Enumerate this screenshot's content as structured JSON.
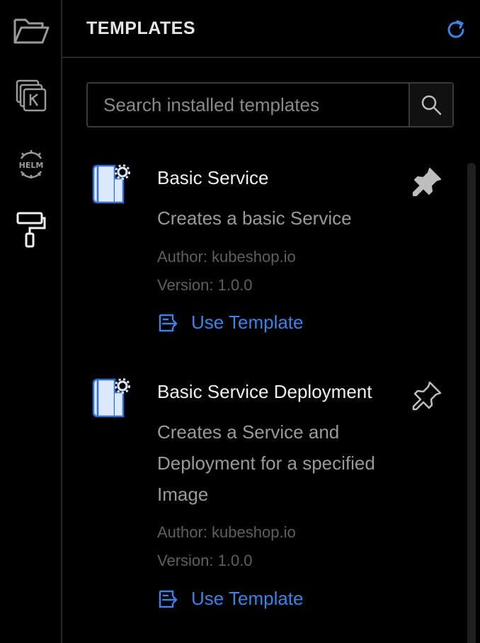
{
  "activity_bar": {
    "items": [
      {
        "icon": "folder-open-icon",
        "active": false
      },
      {
        "icon": "kustomize-icon",
        "active": false
      },
      {
        "icon": "helm-icon",
        "label": "HELM",
        "active": false
      },
      {
        "icon": "paint-roller-icon",
        "active": true
      }
    ]
  },
  "panel": {
    "title": "TEMPLATES",
    "refresh_icon": "refresh-icon"
  },
  "search": {
    "placeholder": "Search installed templates",
    "value": ""
  },
  "templates": [
    {
      "name": "Basic Service",
      "description": "Creates a basic Service",
      "author": "Author: kubeshop.io",
      "version": "Version: 1.0.0",
      "action_label": "Use Template",
      "pinned": true
    },
    {
      "name": "Basic Service Deployment",
      "description": "Creates a Service and Deployment for a specified Image",
      "author": "Author: kubeshop.io",
      "version": "Version: 1.0.0",
      "action_label": "Use Template",
      "pinned": false
    }
  ],
  "colors": {
    "accent": "#3e82e5",
    "background": "#000000",
    "icon_blue": "#2f6fd6"
  }
}
